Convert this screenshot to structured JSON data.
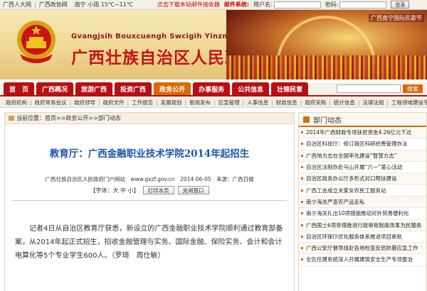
{
  "topbar": {
    "links": [
      "广西人大网",
      "广西政协网"
    ],
    "weather": "南宁 小雨 15℃~11℃",
    "notice": "点击下载本站邮件接收器",
    "mail_label": "邮件系统:",
    "username_label": "用户名:",
    "password_label": "密码:",
    "login_button": "登录"
  },
  "header": {
    "pinyin": "Gvangjsih Bouxcuengh Swcigih Yinzminz Cwngfuj",
    "site_name": "广西壮族自治区人民政府",
    "banner_caption": "广西南宁国际民歌节"
  },
  "nav": {
    "tabs": [
      "首　页",
      "广西概况",
      "旅游广西",
      "投资广西",
      "政务公开",
      "办事服务",
      "公共信息",
      "壮锦民意"
    ],
    "active_index": 4,
    "search_button": "搜索"
  },
  "subnav": {
    "items": [
      "政府机构",
      "政府常务会议",
      "政府领导",
      "政府文件",
      "工作报告",
      "发展规划",
      "新闻发布",
      "应急管理",
      "人事信息",
      "财政信息",
      "政府采购",
      "统计信息",
      "法律法规",
      "工程领域建设专栏"
    ]
  },
  "breadcrumb": {
    "text": "当前位置：首页>>政务公开>>部门动态"
  },
  "article": {
    "title": "教育厅：广西金融职业技术学院2014年起招生",
    "meta": "广西壮族自治区人民政府门户网站　www.gxzf.gov.cn　2014-06-05　来源：广西日报",
    "font_label": "【字体：大 中 小】",
    "print_button": "打印本页",
    "close_button": "关闭窗口",
    "body": "记者4日从自治区教育厅获悉，新设立的广西金融职业技术学院顺利通过教育部备案，从2014年起正式招生，招收金融管理与实务、国际金融、保险实务、会计和会计电算化等5个专业学生600人。（罗琦　周仕敏）"
  },
  "sidebar": {
    "title": "部门动态",
    "items": [
      "2014年广西财政专项扶贫资金4.26亿元下达",
      "自治区科技厅：修订我区科研经费管理办法",
      "广西地方志在全国率先建设“智慧方志”",
      "自治区法制办赴马山开展“六一”爱心活动",
      "自治区政务办公厅多形式对口帮扶建设",
      "广西工会成立关爱女农民工服务站",
      "南宁海关严查农产品走私",
      "南宁海关扎出10项措施推动对外贸易便利化",
      "广西国土6项举措推进行政审批制度改革为民服务",
      "自治区环保厅优化服务体系推进项目审批",
      "广西公安厅督导组赴各地检查反恐防暴应急工作",
      "全区住建系统深入开展建筑安全生产专项整治"
    ]
  },
  "colors": {
    "nav_red": "#b80f14",
    "nav_active": "#d86a07",
    "title_blue": "#1b57a8",
    "site_name_red": "#c4121a"
  }
}
